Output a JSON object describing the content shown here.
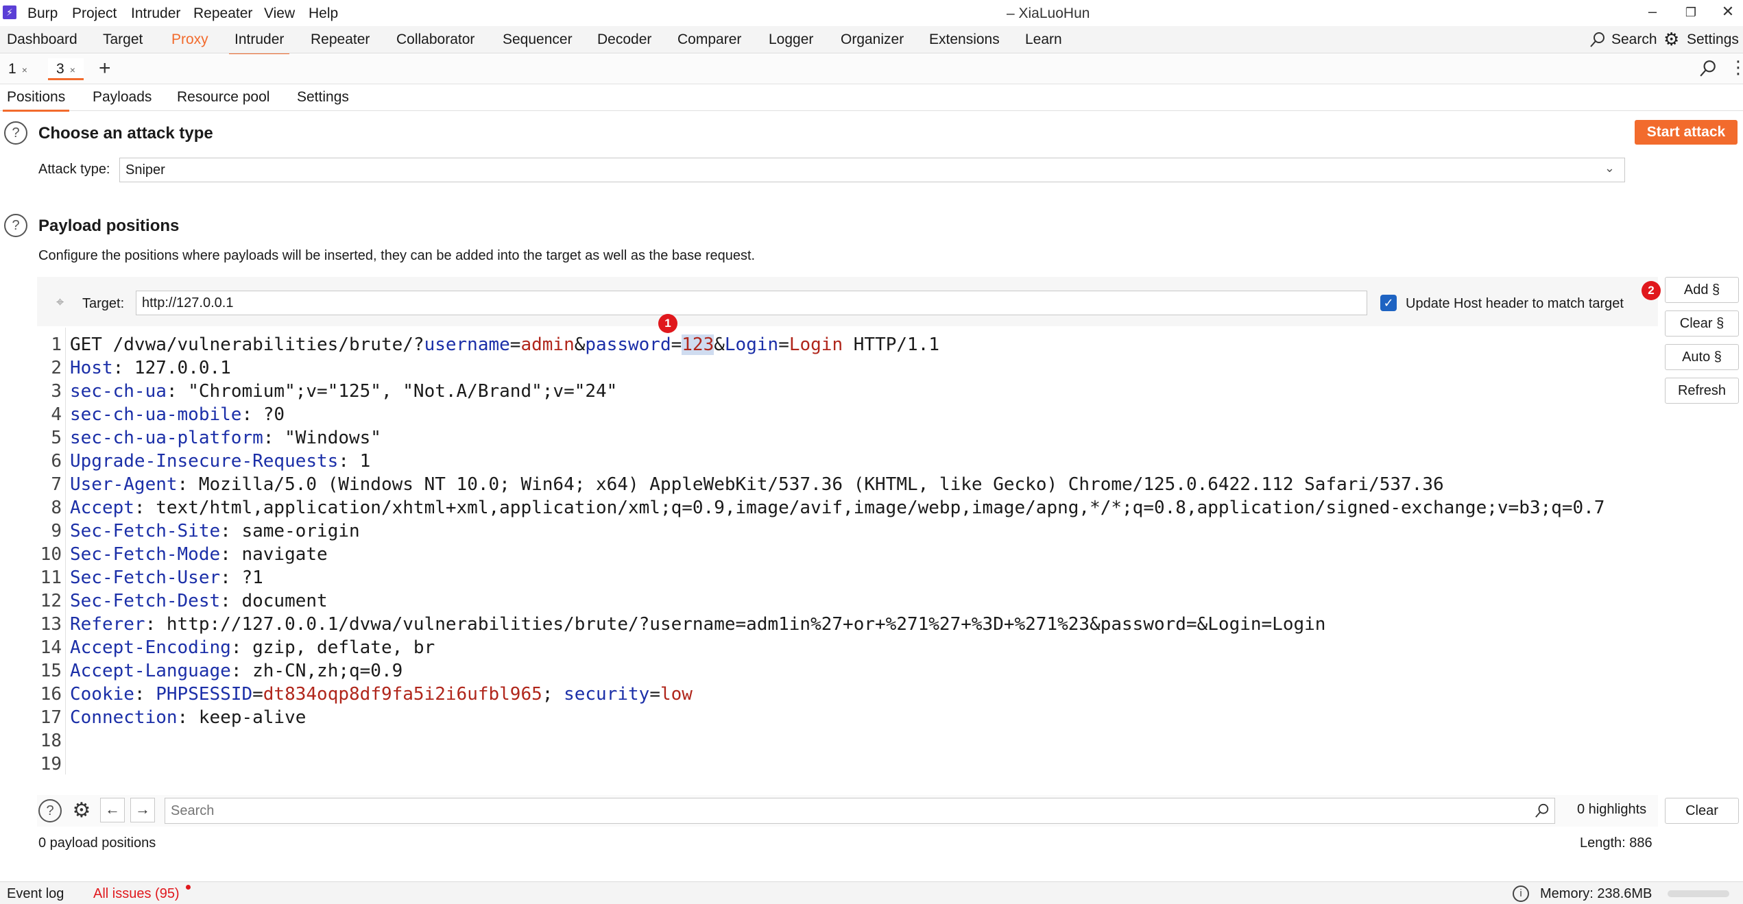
{
  "menubar": {
    "items": [
      "Burp",
      "Project",
      "Intruder",
      "Repeater",
      "View",
      "Help"
    ],
    "window_title": "– XiaLuoHun"
  },
  "main_tabs": [
    "Dashboard",
    "Target",
    "Proxy",
    "Intruder",
    "Repeater",
    "Collaborator",
    "Sequencer",
    "Decoder",
    "Comparer",
    "Logger",
    "Organizer",
    "Extensions",
    "Learn"
  ],
  "top_right": {
    "search": "Search",
    "settings": "Settings"
  },
  "instance_tabs": [
    {
      "label": "1"
    },
    {
      "label": "3"
    }
  ],
  "sub_tabs": [
    "Positions",
    "Payloads",
    "Resource pool",
    "Settings"
  ],
  "attack_type": {
    "heading": "Choose an attack type",
    "start_button": "Start attack",
    "label": "Attack type:",
    "value": "Sniper"
  },
  "payload_positions": {
    "heading": "Payload positions",
    "description": "Configure the positions where payloads will be inserted, they can be added into the target as well as the base request.",
    "target_label": "Target:",
    "target_value": "http://127.0.0.1",
    "update_host_label": "Update Host header to match target",
    "update_host_checked": true,
    "buttons": {
      "add": "Add §",
      "clear": "Clear §",
      "auto": "Auto §",
      "refresh": "Refresh"
    },
    "annotations": [
      "1",
      "2"
    ]
  },
  "request": {
    "line1": {
      "method": "GET /dvwa/vulnerabilities/brute/?",
      "k1": "username",
      "v1": "admin",
      "amp1": "&",
      "k2": "password",
      "eq": "=",
      "v2": "123",
      "amp2": "&",
      "k3": "Login",
      "v3": "Login",
      "proto": " HTTP/1.1"
    },
    "headers": [
      {
        "name": "Host",
        "value": " 127.0.0.1"
      },
      {
        "name": "sec-ch-ua",
        "value": " \"Chromium\";v=\"125\", \"Not.A/Brand\";v=\"24\""
      },
      {
        "name": "sec-ch-ua-mobile",
        "value": " ?0"
      },
      {
        "name": "sec-ch-ua-platform",
        "value": " \"Windows\""
      },
      {
        "name": "Upgrade-Insecure-Requests",
        "value": " 1"
      },
      {
        "name": "User-Agent",
        "value": " Mozilla/5.0 (Windows NT 10.0; Win64; x64) AppleWebKit/537.36 (KHTML, like Gecko) Chrome/125.0.6422.112 Safari/537.36"
      },
      {
        "name": "Accept",
        "value": " text/html,application/xhtml+xml,application/xml;q=0.9,image/avif,image/webp,image/apng,*/*;q=0.8,application/signed-exchange;v=b3;q=0.7"
      },
      {
        "name": "Sec-Fetch-Site",
        "value": " same-origin"
      },
      {
        "name": "Sec-Fetch-Mode",
        "value": " navigate"
      },
      {
        "name": "Sec-Fetch-User",
        "value": " ?1"
      },
      {
        "name": "Sec-Fetch-Dest",
        "value": " document"
      },
      {
        "name": "Referer",
        "value": " http://127.0.0.1/dvwa/vulnerabilities/brute/?username=adm1in%27+or+%271%27+%3D+%271%23&password=&Login=Login"
      },
      {
        "name": "Accept-Encoding",
        "value": " gzip, deflate, br"
      },
      {
        "name": "Accept-Language",
        "value": " zh-CN,zh;q=0.9"
      }
    ],
    "cookie": {
      "name": "Cookie",
      "k1": "PHPSESSID",
      "v1": "dt834oqp8df9fa5i2i6ufbl965",
      "sep": "; ",
      "k2": "security",
      "v2": "low"
    },
    "connection": {
      "name": "Connection",
      "value": " keep-alive"
    },
    "line_numbers": [
      "1",
      "2",
      "3",
      "4",
      "5",
      "6",
      "7",
      "8",
      "9",
      "10",
      "11",
      "12",
      "13",
      "14",
      "15",
      "16",
      "17",
      "18",
      "19"
    ]
  },
  "search_bar": {
    "placeholder": "Search",
    "highlights": "0 highlights",
    "clear": "Clear"
  },
  "footer": {
    "positions": "0 payload positions",
    "length": "Length: 886"
  },
  "statusbar": {
    "event_log": "Event log",
    "issues": "All issues (95)",
    "memory": "Memory: 238.6MB"
  },
  "colors": {
    "accent": "#f26b2d",
    "key_blue": "#1b2fa8",
    "value_red": "#b0261b",
    "checkbox_blue": "#1e63c2"
  }
}
